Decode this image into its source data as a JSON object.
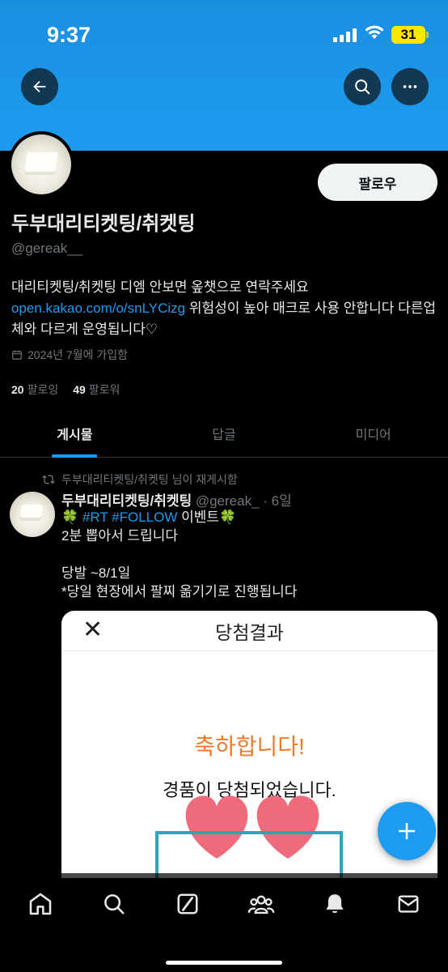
{
  "status_bar": {
    "time": "9:37",
    "battery": "31"
  },
  "header": {
    "back_icon": "arrow-left-icon",
    "search_icon": "search-icon",
    "more_icon": "more-horizontal-icon"
  },
  "profile": {
    "follow_label": "팔로우",
    "display_name": "두부대리티켓팅/취켓팅",
    "handle": "@gereak__",
    "bio_text": "대리티켓팅/취켓팅 디엠 안보면 옾챗으로 연락주세요 ",
    "bio_link": "open.kakao.com/o/snLYCizg",
    "bio_text_after": " 위험성이 높아 매크로 사용 안합니다 다른업체와 다르게 운영됩니다♡",
    "joined": "2024년 7월에 가입함",
    "following_count": "20",
    "following_label": "팔로잉",
    "followers_count": "49",
    "followers_label": "팔로워"
  },
  "tabs": [
    {
      "label": "게시물"
    },
    {
      "label": "답글"
    },
    {
      "label": "미디어"
    }
  ],
  "tweet": {
    "repost_label": "두부대리티켓팅/취켓팅 님이 재게시함",
    "author_name": "두부대리티켓팅/취켓팅",
    "author_meta": " @gereak_ · 6일",
    "line1_prefix": "🍀 ",
    "hashtag1": "#RT",
    "hashtag2": "#FOLLOW",
    "line1_suffix": " 이벤트🍀",
    "line2": "2분 뽑아서 드립니다",
    "line3": "",
    "line4": "당발 ~8/1일",
    "line5": "*당일 현장에서 팔찌 옮기기로 진행됩니다",
    "image": {
      "close": "✕",
      "title": "당첨결과",
      "congrats": "축하합니다!",
      "prize": "경품이 당첨되었습니다."
    }
  },
  "fab": {
    "icon": "plus-icon"
  },
  "bottom_nav": [
    {
      "icon": "home-icon"
    },
    {
      "icon": "search-icon"
    },
    {
      "icon": "grok-icon"
    },
    {
      "icon": "communities-icon"
    },
    {
      "icon": "notifications-icon"
    },
    {
      "icon": "messages-icon"
    }
  ],
  "colors": {
    "accent": "#1d9bf0",
    "background": "#000000",
    "secondary_text": "#71767b"
  }
}
